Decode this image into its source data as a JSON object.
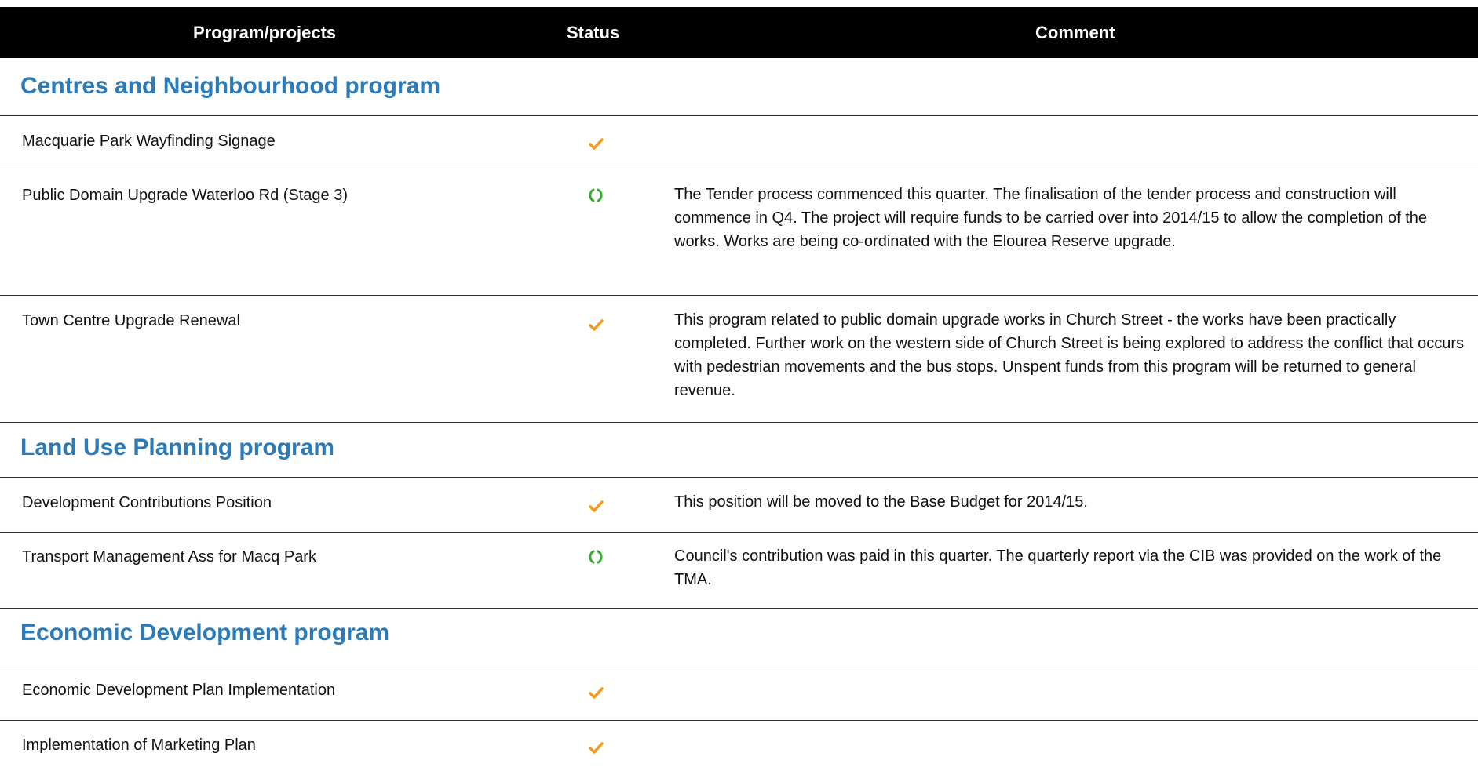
{
  "table": {
    "headers": {
      "program": "Program/projects",
      "status": "Status",
      "comment": "Comment"
    }
  },
  "sections": [
    {
      "title": "Centres and Neighbourhood program",
      "rows": [
        {
          "name": "Macquarie Park Wayfinding Signage",
          "status": "check-icon",
          "comment": ""
        },
        {
          "name": "Public Domain Upgrade Waterloo Rd (Stage 3)",
          "status": "in-progress-icon",
          "comment": "The Tender process commenced this quarter. The finalisation of the tender process and construction will commence in Q4. The project will require funds to be carried over into 2014/15 to allow the completion of the works. Works are being co-ordinated with the Elourea Reserve upgrade."
        },
        {
          "name": "Town Centre Upgrade Renewal",
          "status": "check-icon",
          "comment": "This program related to public domain upgrade works in Church Street - the works have been practically completed. Further work on the western side of Church Street is being explored to address the conflict that occurs with pedestrian movements and the bus stops. Unspent funds from this program will be returned to general revenue."
        }
      ]
    },
    {
      "title": "Land Use Planning program",
      "rows": [
        {
          "name": "Development Contributions Position",
          "status": "check-icon",
          "comment": "This position will be moved to the Base Budget for 2014/15."
        },
        {
          "name": "Transport Management  Ass for Macq Park",
          "status": "in-progress-icon",
          "comment": "Council's contribution was paid in this quarter. The quarterly report via the CIB was provided on the work of the TMA."
        }
      ]
    },
    {
      "title": "Economic Development program",
      "rows": [
        {
          "name": "Economic Development Plan Implementation",
          "status": "check-icon",
          "comment": ""
        },
        {
          "name": "Implementation of Marketing Plan",
          "status": "check-icon",
          "comment": ""
        }
      ]
    }
  ],
  "colors": {
    "header_bg": "#000000",
    "section_title": "#2b7bb9",
    "check": "#f29a1f",
    "in_progress": "#3aa935"
  }
}
